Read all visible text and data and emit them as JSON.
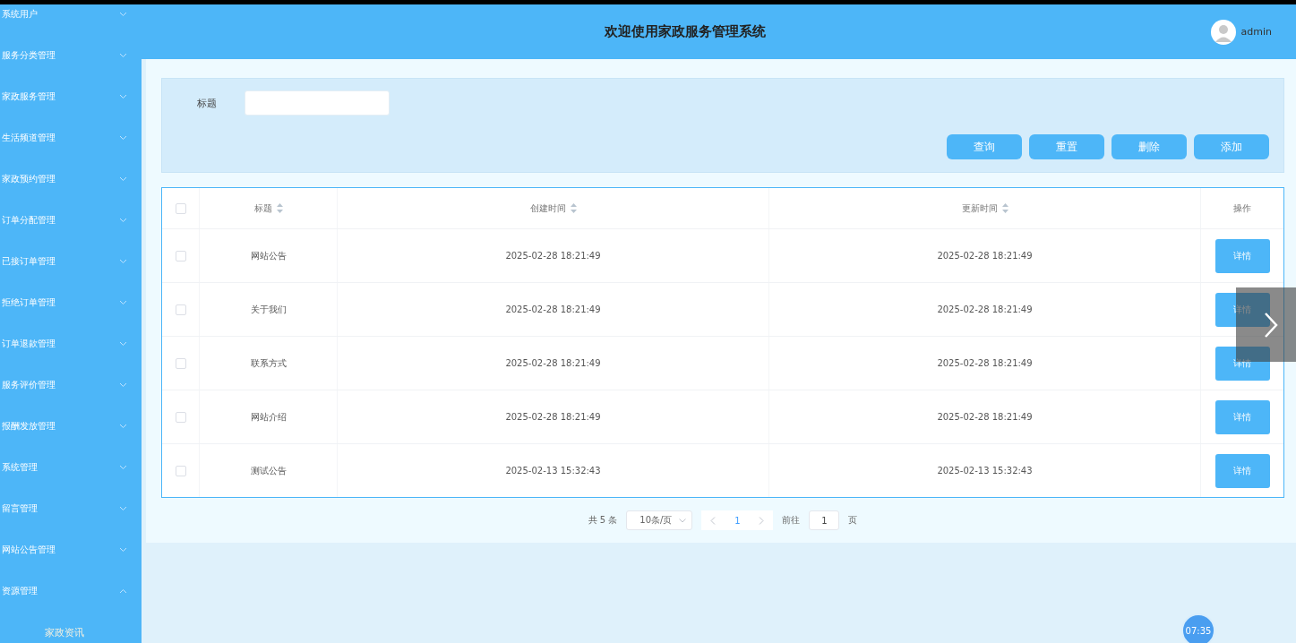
{
  "sidebar": {
    "items": [
      {
        "label": "系统用户",
        "expanded": false
      },
      {
        "label": "服务分类管理",
        "expanded": false
      },
      {
        "label": "家政服务管理",
        "expanded": false
      },
      {
        "label": "生活频道管理",
        "expanded": false
      },
      {
        "label": "家政预约管理",
        "expanded": false
      },
      {
        "label": "订单分配管理",
        "expanded": false
      },
      {
        "label": "已接订单管理",
        "expanded": false
      },
      {
        "label": "拒绝订单管理",
        "expanded": false
      },
      {
        "label": "订单退款管理",
        "expanded": false
      },
      {
        "label": "服务评价管理",
        "expanded": false
      },
      {
        "label": "报酬发放管理",
        "expanded": false
      },
      {
        "label": "系统管理",
        "expanded": false
      },
      {
        "label": "留言管理",
        "expanded": false
      },
      {
        "label": "网站公告管理",
        "expanded": false
      },
      {
        "label": "资源管理",
        "expanded": true,
        "children": [
          {
            "label": "家政资讯"
          }
        ]
      }
    ]
  },
  "header": {
    "title": "欢迎使用家政服务管理系统",
    "user": "admin"
  },
  "search": {
    "label": "标题",
    "buttons": [
      "查询",
      "重置",
      "删除",
      "添加"
    ]
  },
  "table": {
    "select_all_checked": false,
    "columns": [
      "标题",
      "创建时间",
      "更新时间",
      "操作"
    ],
    "rows": [
      {
        "title": "网站公告",
        "created": "2025-02-28 18:21:49",
        "updated": "2025-02-28 18:21:49",
        "action": "详情",
        "checked": false
      },
      {
        "title": "关于我们",
        "created": "2025-02-28 18:21:49",
        "updated": "2025-02-28 18:21:49",
        "action": "详情",
        "checked": false
      },
      {
        "title": "联系方式",
        "created": "2025-02-28 18:21:49",
        "updated": "2025-02-28 18:21:49",
        "action": "详情",
        "checked": false
      },
      {
        "title": "网站介绍",
        "created": "2025-02-28 18:21:49",
        "updated": "2025-02-28 18:21:49",
        "action": "详情",
        "checked": false
      },
      {
        "title": "测试公告",
        "created": "2025-02-13 15:32:43",
        "updated": "2025-02-13 15:32:43",
        "action": "详情",
        "checked": false
      }
    ]
  },
  "pagination": {
    "total": "共 5 条",
    "page_size": "10条/页",
    "current_page": "1",
    "goto_label": "前往",
    "goto_value": "1",
    "page_unit": "页"
  },
  "clock": "07:35"
}
